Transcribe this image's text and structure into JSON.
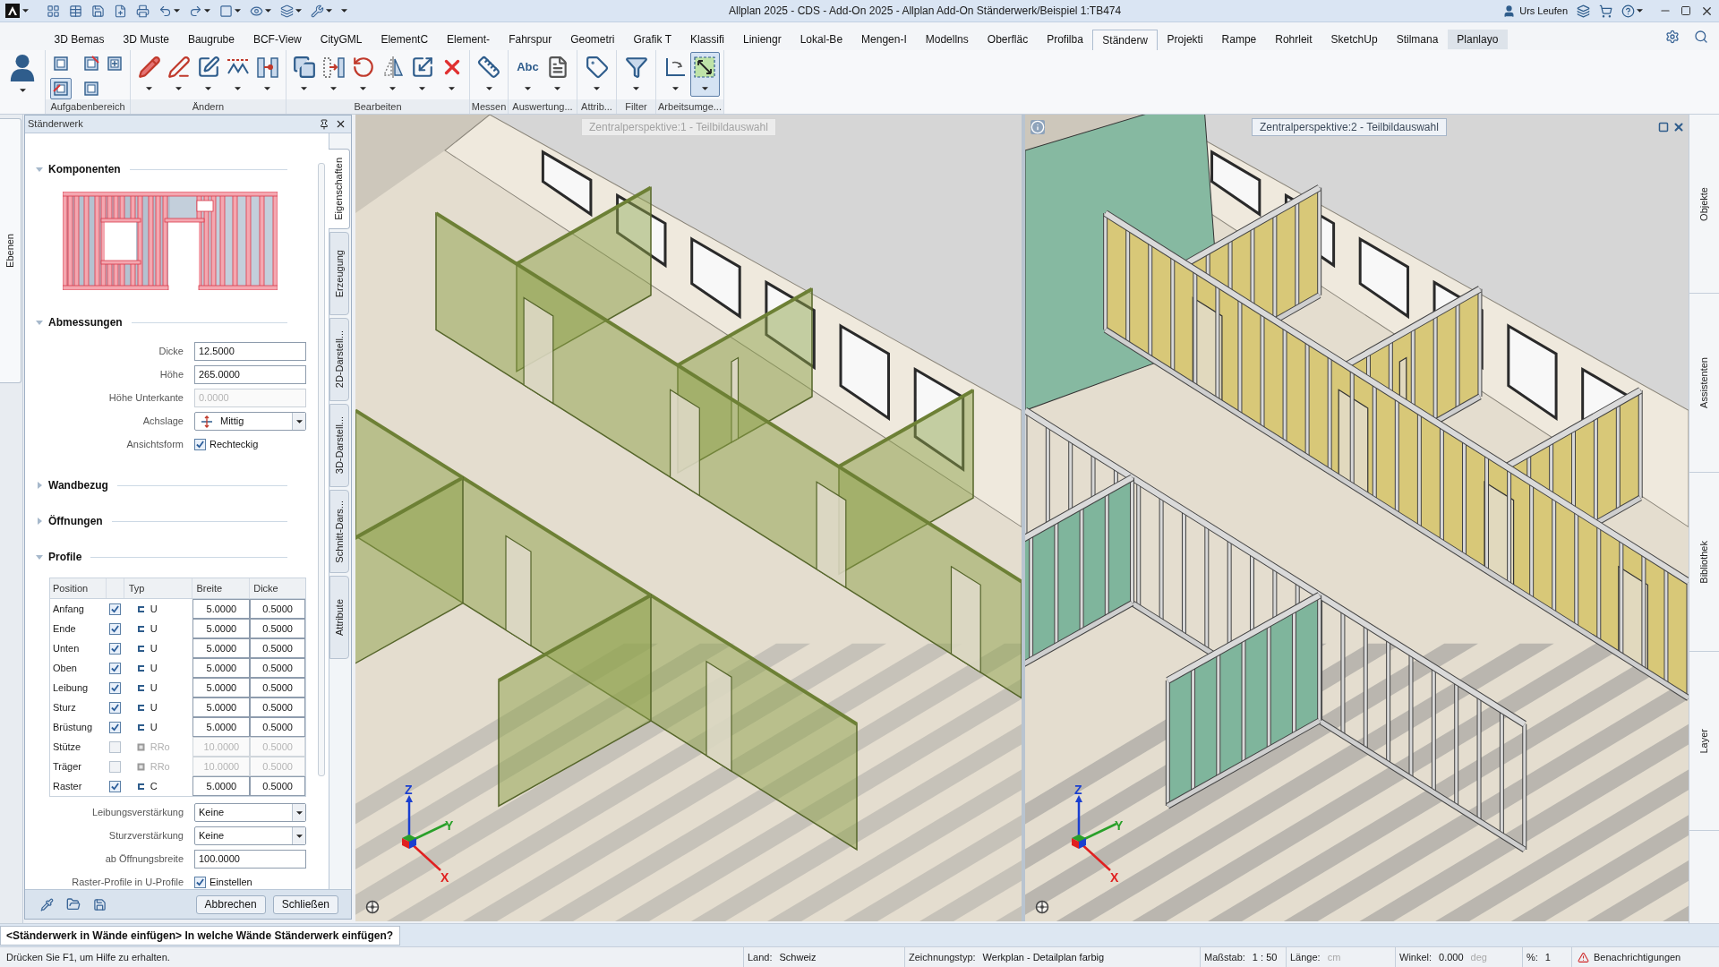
{
  "title_bar": {
    "title": "Allplan 2025 - CDS - Add-On 2025 - Allplan Add-On Ständerwerk/Beispiel 1:TB474",
    "user": "Urs Leufen"
  },
  "menu_tabs": [
    {
      "label": "3D Bemas",
      "selected": false,
      "hovered": false
    },
    {
      "label": "3D Muste",
      "selected": false,
      "hovered": false
    },
    {
      "label": "Baugrube",
      "selected": false,
      "hovered": false
    },
    {
      "label": "BCF-View",
      "selected": false,
      "hovered": false
    },
    {
      "label": "CityGML",
      "selected": false,
      "hovered": false
    },
    {
      "label": "ElementC",
      "selected": false,
      "hovered": false
    },
    {
      "label": "Element-",
      "selected": false,
      "hovered": false
    },
    {
      "label": "Fahrspur",
      "selected": false,
      "hovered": false
    },
    {
      "label": "Geometri",
      "selected": false,
      "hovered": false
    },
    {
      "label": "Grafik T",
      "selected": false,
      "hovered": false
    },
    {
      "label": "Klassifi",
      "selected": false,
      "hovered": false
    },
    {
      "label": "Liniengr",
      "selected": false,
      "hovered": false
    },
    {
      "label": "Lokal-Be",
      "selected": false,
      "hovered": false
    },
    {
      "label": "Mengen-I",
      "selected": false,
      "hovered": false
    },
    {
      "label": "Modellns",
      "selected": false,
      "hovered": false
    },
    {
      "label": "Oberfläc",
      "selected": false,
      "hovered": false
    },
    {
      "label": "Profilba",
      "selected": false,
      "hovered": false
    },
    {
      "label": "Ständerw",
      "selected": true,
      "hovered": false
    },
    {
      "label": "Projekti",
      "selected": false,
      "hovered": false
    },
    {
      "label": "Rampe",
      "selected": false,
      "hovered": false
    },
    {
      "label": "Rohrleit",
      "selected": false,
      "hovered": false
    },
    {
      "label": "SketchUp",
      "selected": false,
      "hovered": false
    },
    {
      "label": "Stilmana",
      "selected": false,
      "hovered": false
    },
    {
      "label": "Planlayo",
      "selected": false,
      "hovered": true
    }
  ],
  "ribbon": {
    "groups": [
      {
        "label": "Aufgabenbereich",
        "tools": [
          {
            "selected": false
          },
          {
            "selected": true
          },
          {
            "selected": false
          },
          {
            "selected": false
          },
          {
            "selected": false
          }
        ]
      },
      {
        "label": "Ändern",
        "tools": [
          {
            "selected": false
          },
          {
            "selected": false
          },
          {
            "selected": false
          },
          {
            "selected": false
          },
          {
            "selected": false
          }
        ]
      },
      {
        "label": "Bearbeiten",
        "tools": [
          {
            "selected": false
          },
          {
            "selected": false
          },
          {
            "selected": false
          },
          {
            "selected": false
          },
          {
            "selected": false
          },
          {
            "selected": false
          }
        ]
      },
      {
        "label": "Messen",
        "tools": [
          {
            "selected": false
          }
        ]
      },
      {
        "label": "Auswertung...",
        "tool_text": "Abc",
        "tools": [
          {
            "selected": false
          },
          {
            "selected": false
          }
        ]
      },
      {
        "label": "Attrib...",
        "tools": [
          {
            "selected": false
          }
        ]
      },
      {
        "label": "Filter",
        "tools": [
          {
            "selected": false
          }
        ]
      },
      {
        "label": "Arbeitsumge...",
        "tools": [
          {
            "selected": false
          },
          {
            "selected": true
          }
        ]
      }
    ]
  },
  "left_dock": {
    "tabs": [
      {
        "label": "Ebenen"
      }
    ]
  },
  "panel": {
    "title": "Ständerwerk",
    "sections": [
      {
        "kind": "preview",
        "label": "Komponenten",
        "expanded": true
      },
      {
        "kind": "fields",
        "label": "Abmessungen",
        "expanded": true,
        "fields": [
          {
            "kind": "input",
            "label": "Dicke",
            "value": "12.5000",
            "disabled": false
          },
          {
            "kind": "input",
            "label": "Höhe",
            "value": "265.0000",
            "disabled": false
          },
          {
            "kind": "input",
            "label": "Höhe Unterkante",
            "value": "0.0000",
            "disabled": true
          },
          {
            "kind": "iconselect",
            "label": "Achslage",
            "value": "Mittig"
          },
          {
            "kind": "checkbox",
            "label": "Ansichtsform",
            "value": "Rechteckig",
            "checked": true
          }
        ]
      },
      {
        "label": "Wandbezug",
        "expanded": false
      },
      {
        "label": "Öffnungen",
        "expanded": false
      },
      {
        "kind": "profiles",
        "label": "Profile",
        "expanded": true,
        "columns": [
          "Position",
          "Typ",
          "Breite",
          "Dicke"
        ],
        "rows": [
          {
            "position": "Anfang",
            "checked": true,
            "kind": "channel",
            "type": "U",
            "breite": "5.0000",
            "dicke": "0.5000"
          },
          {
            "position": "Ende",
            "checked": true,
            "kind": "channel",
            "type": "U",
            "breite": "5.0000",
            "dicke": "0.5000"
          },
          {
            "position": "Unten",
            "checked": true,
            "kind": "channel",
            "type": "U",
            "breite": "5.0000",
            "dicke": "0.5000"
          },
          {
            "position": "Oben",
            "checked": true,
            "kind": "channel",
            "type": "U",
            "breite": "5.0000",
            "dicke": "0.5000"
          },
          {
            "position": "Leibung",
            "checked": true,
            "kind": "channel",
            "type": "U",
            "breite": "5.0000",
            "dicke": "0.5000"
          },
          {
            "position": "Sturz",
            "checked": true,
            "kind": "channel",
            "type": "U",
            "breite": "5.0000",
            "dicke": "0.5000"
          },
          {
            "position": "Brüstung",
            "checked": true,
            "kind": "channel",
            "type": "U",
            "breite": "5.0000",
            "dicke": "0.5000"
          },
          {
            "position": "Stütze",
            "checked": false,
            "kind": "tube",
            "type": "RRo",
            "breite": "10.0000",
            "dicke": "0.5000"
          },
          {
            "position": "Träger",
            "checked": false,
            "kind": "tube",
            "type": "RRo",
            "breite": "10.0000",
            "dicke": "0.5000"
          },
          {
            "position": "Raster",
            "checked": true,
            "kind": "channel",
            "type": "C",
            "breite": "5.0000",
            "dicke": "0.5000"
          }
        ],
        "fields": [
          {
            "kind": "select",
            "label": "Leibungsverstärkung",
            "value": "Keine"
          },
          {
            "kind": "select",
            "label": "Sturzverstärkung",
            "value": "Keine"
          },
          {
            "kind": "input",
            "label": "ab Öffnungsbreite",
            "value": "100.0000",
            "disabled": false
          },
          {
            "kind": "checkbox",
            "label": "Raster-Profile in U-Profile",
            "value": "Einstellen",
            "checked": true
          }
        ]
      }
    ],
    "buttons": [
      "Abbrechen",
      "Schließen"
    ],
    "side_tabs": [
      {
        "label": "Eigenschaften",
        "selected": true
      },
      {
        "label": "Erzeugung",
        "selected": false
      },
      {
        "label": "2D-Darstell...",
        "selected": false
      },
      {
        "label": "3D-Darstell...",
        "selected": false
      },
      {
        "label": "Schnitt-Dars...",
        "selected": false
      },
      {
        "label": "Attribute",
        "selected": false
      }
    ]
  },
  "viewports": [
    {
      "title": "Zentralperspektive:1 - Teilbildauswahl",
      "active": false,
      "kind": "translucent",
      "axes": {
        "x": "X",
        "y": "Y",
        "z": "Z"
      }
    },
    {
      "title": "Zentralperspektive:2 - Teilbildauswahl",
      "active": true,
      "kind": "framing",
      "axes": {
        "x": "X",
        "y": "Y",
        "z": "Z"
      }
    }
  ],
  "right_dock": {
    "tabs": [
      {
        "label": "Objekte"
      },
      {
        "label": "Assistenten"
      },
      {
        "label": "Bibliothek"
      },
      {
        "label": "Layer"
      }
    ]
  },
  "command_line": "<Ständerwerk in Wände einfügen> In welche Wände Ständerwerk einfügen?",
  "status_bar": {
    "help": "Drücken Sie F1, um Hilfe zu erhalten.",
    "items": [
      {
        "label": "Land:",
        "value": "Schweiz"
      },
      {
        "label": "Zeichnungstyp:",
        "value": "Werkplan - Detailplan farbig"
      },
      {
        "label": "Maßstab:",
        "value": "1 : 50"
      },
      {
        "label": "Länge:",
        "unit": "cm"
      },
      {
        "label": "Winkel:",
        "value": "0.000",
        "unit": "deg"
      },
      {
        "label": "%:",
        "value": "1"
      }
    ],
    "notifications": "Benachrichtigungen"
  }
}
